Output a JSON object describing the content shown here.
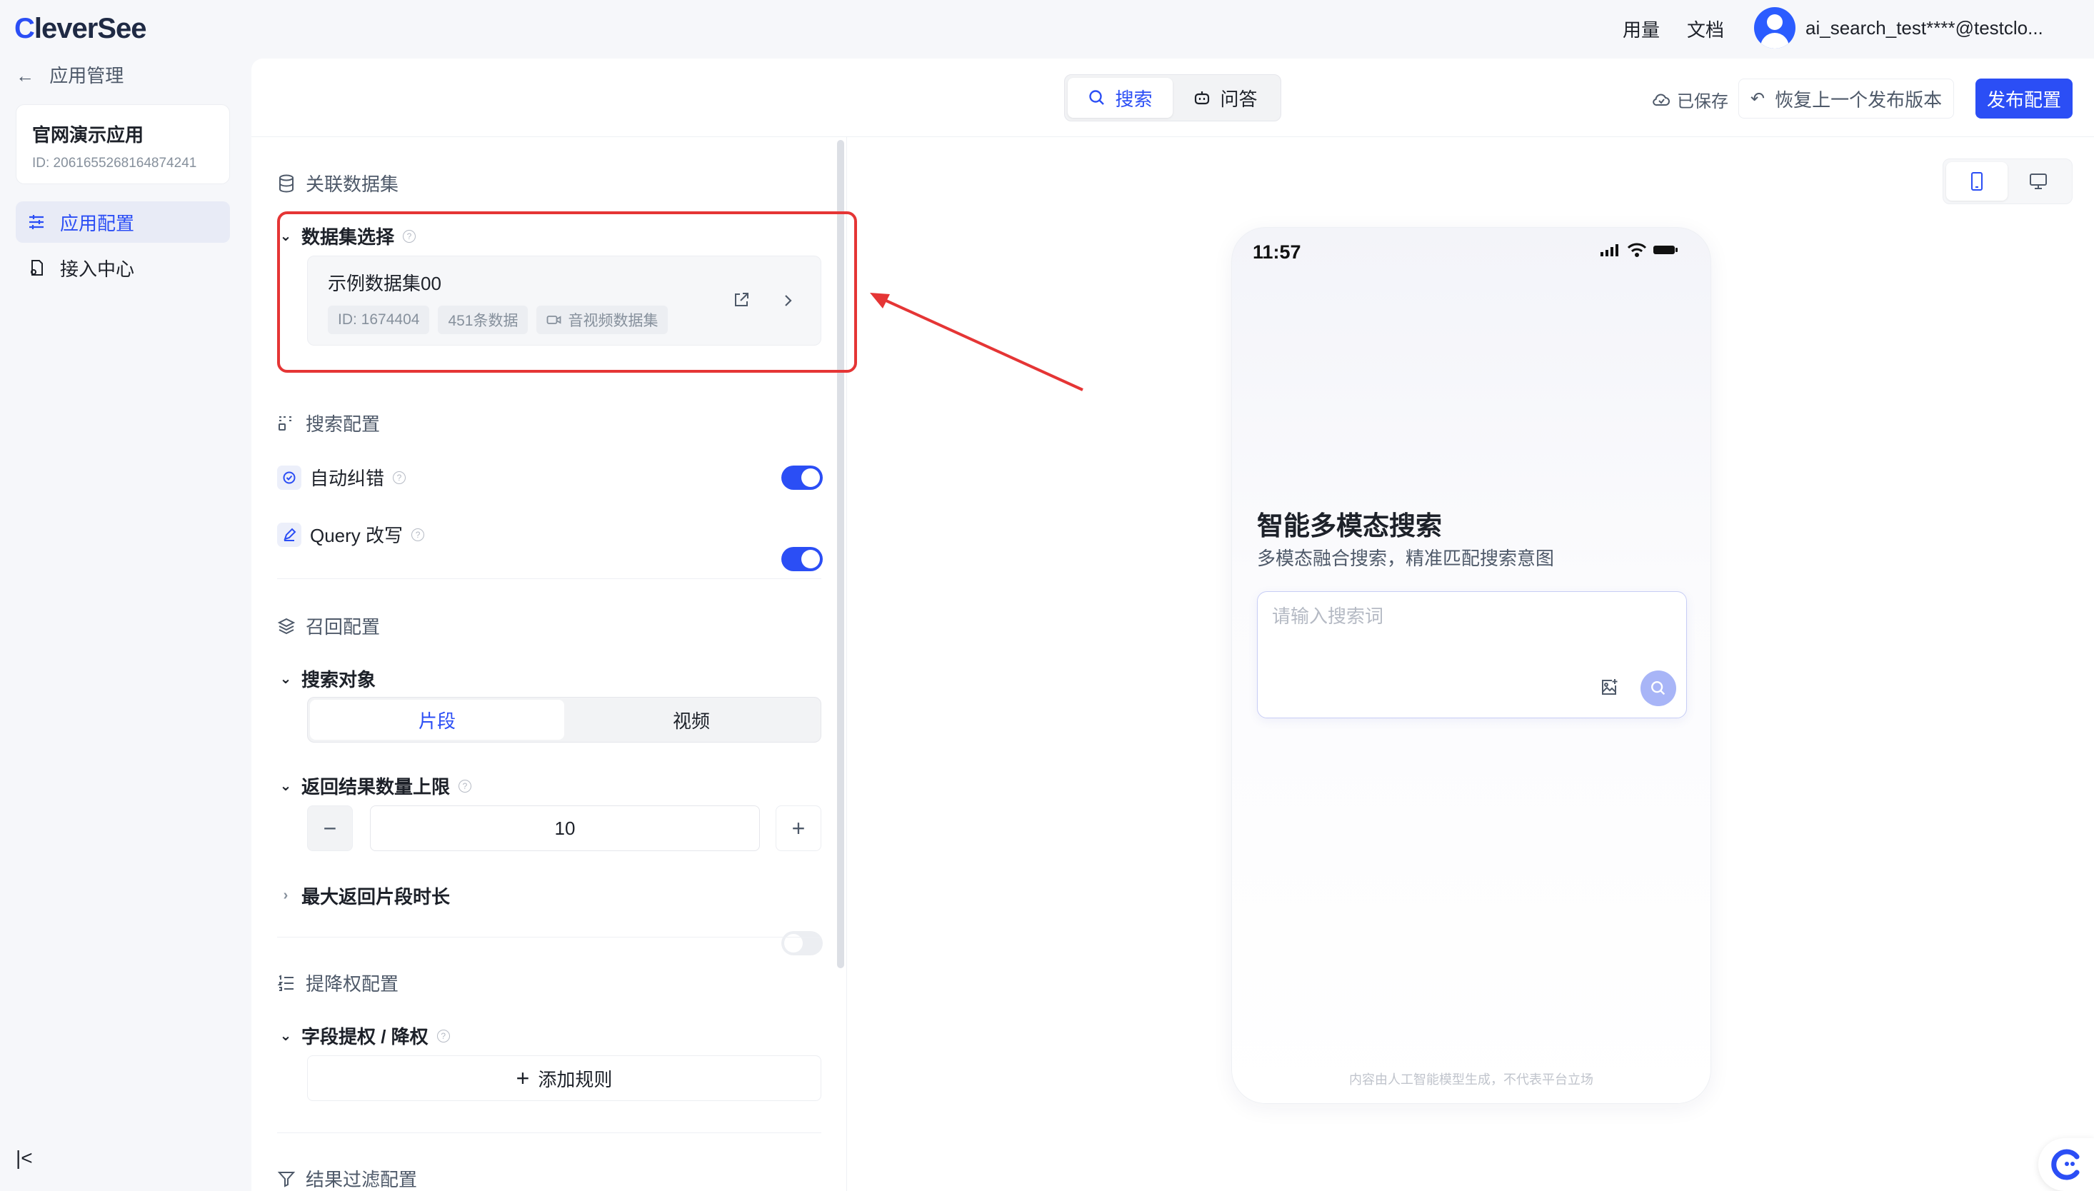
{
  "app": {
    "logo": "CleverSee",
    "logo_first": "C",
    "logo_rest": "leverSee"
  },
  "topbar": {
    "usage": "用量",
    "docs": "文档",
    "user": "ai_search_test****@testclo..."
  },
  "sidebar": {
    "back_label": "应用管理",
    "app_name": "官网演示应用",
    "app_id": "ID: 2061655268164874241",
    "items": [
      {
        "label": "应用配置",
        "icon": "sliders-icon",
        "active": true
      },
      {
        "label": "接入中心",
        "icon": "plug-doc-icon",
        "active": false
      }
    ]
  },
  "header": {
    "tabs": [
      {
        "label": "搜索",
        "icon": "search-icon"
      },
      {
        "label": "问答",
        "icon": "robot-icon"
      }
    ],
    "saved": "已保存",
    "restore": "恢复上一个发布版本",
    "publish": "发布配置"
  },
  "config": {
    "dataset_section": "关联数据集",
    "dataset_select": "数据集选择",
    "dataset": {
      "name": "示例数据集00",
      "id": "ID: 1674404",
      "count": "451条数据",
      "type": "音视频数据集"
    },
    "search_section": "搜索配置",
    "auto_correct": {
      "label": "自动纠错",
      "enabled": true
    },
    "query_rewrite": {
      "label": "Query 改写",
      "enabled": true
    },
    "recall_section": "召回配置",
    "search_target": {
      "label": "搜索对象",
      "options": [
        "片段",
        "视频"
      ],
      "selected": "片段"
    },
    "result_limit": {
      "label": "返回结果数量上限",
      "value": "10"
    },
    "max_clip": {
      "label": "最大返回片段时长",
      "enabled": false
    },
    "boost_section": "提降权配置",
    "field_boost": "字段提权 / 降权",
    "add_rule": "添加规则",
    "filter_section": "结果过滤配置"
  },
  "preview": {
    "time": "11:57",
    "title": "智能多模态搜索",
    "subtitle": "多模态融合搜索，精准匹配搜索意图",
    "placeholder": "请输入搜索词",
    "footer": "内容由人工智能模型生成，不代表平台立场"
  },
  "colors": {
    "accent": "#2b4ef5",
    "annotation": "#e53535"
  }
}
